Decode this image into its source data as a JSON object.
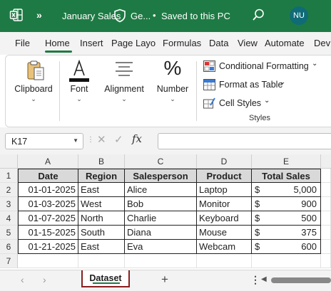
{
  "titlebar": {
    "app_icon": "excel-logo-icon",
    "overflow": "»",
    "file_name": "January Sales",
    "sensitivity_short": "Ge...",
    "separator": "•",
    "save_status": "Saved to this PC",
    "search_icon": "search-icon",
    "avatar_initials": "NU"
  },
  "tabs": [
    "File",
    "Home",
    "Insert",
    "Page Layo",
    "Formulas",
    "Data",
    "View",
    "Automate",
    "Dev"
  ],
  "active_tab": "Home",
  "ribbon": {
    "clipboard": "Clipboard",
    "font": "Font",
    "alignment": "Alignment",
    "number": "Number",
    "number_glyph": "%",
    "conditional_formatting": "Conditional Formatting",
    "format_as_table": "Format as Table",
    "cell_styles": "Cell Styles",
    "styles_group": "Styles"
  },
  "formula_bar": {
    "name_box": "K17",
    "fx": "fx",
    "value": ""
  },
  "grid": {
    "columns": [
      "A",
      "B",
      "C",
      "D",
      "E"
    ],
    "row_numbers": [
      "1",
      "2",
      "3",
      "4",
      "5",
      "6",
      "7"
    ],
    "headers": [
      "Date",
      "Region",
      "Salesperson",
      "Product",
      "Total Sales"
    ],
    "rows": [
      {
        "date": "01-01-2025",
        "region": "East",
        "salesperson": "Alice",
        "product": "Laptop",
        "currency": "$",
        "amount": "5,000"
      },
      {
        "date": "01-03-2025",
        "region": "West",
        "salesperson": "Bob",
        "product": "Monitor",
        "currency": "$",
        "amount": "900"
      },
      {
        "date": "01-07-2025",
        "region": "North",
        "salesperson": "Charlie",
        "product": "Keyboard",
        "currency": "$",
        "amount": "500"
      },
      {
        "date": "01-15-2025",
        "region": "South",
        "salesperson": "Diana",
        "product": "Mouse",
        "currency": "$",
        "amount": "375"
      },
      {
        "date": "01-21-2025",
        "region": "East",
        "salesperson": "Eva",
        "product": "Webcam",
        "currency": "$",
        "amount": "600"
      }
    ]
  },
  "sheets": {
    "active": "Dataset",
    "add": "+",
    "more": "⋮"
  },
  "colors": {
    "titlebar_bg": "#1e7a44",
    "accent": "#1e7a44",
    "header_fill": "#d9d9d9",
    "avatar_bg": "#0f6b77",
    "active_sheet_border": "#8b1e1e"
  }
}
